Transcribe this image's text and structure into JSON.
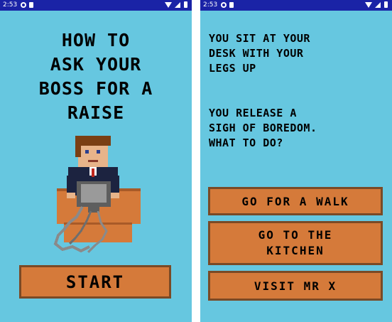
{
  "status_bar": {
    "left_time": "2:53",
    "right_time": "2:53",
    "color": "#1a23a6"
  },
  "left_screen": {
    "title_lines": [
      "HOW TO",
      "ASK YOUR",
      "BOSS FOR A",
      "RAISE"
    ],
    "start_label": "START",
    "background": "#66c7e0",
    "button_color": "#d57a3a"
  },
  "right_screen": {
    "story_1_lines": [
      "YOU SIT AT YOUR",
      "DESK WITH YOUR",
      "LEGS UP"
    ],
    "story_2_lines": [
      "YOU RELEASE A",
      "SIGH OF BOREDOM.",
      "WHAT TO DO?"
    ],
    "choices": {
      "walk": "GO FOR A WALK",
      "kitchen_lines": [
        "GO TO THE",
        "KITCHEN"
      ],
      "visit": "VISIT MR X"
    }
  }
}
